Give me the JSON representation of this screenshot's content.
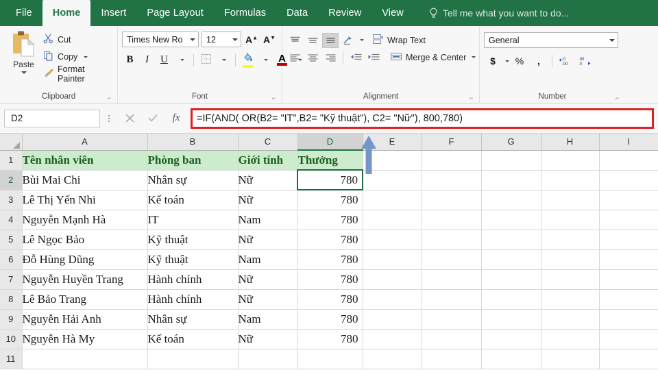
{
  "ribbon": {
    "tabs": [
      {
        "label": "File",
        "active": false
      },
      {
        "label": "Home",
        "active": true
      },
      {
        "label": "Insert",
        "active": false
      },
      {
        "label": "Page Layout",
        "active": false
      },
      {
        "label": "Formulas",
        "active": false
      },
      {
        "label": "Data",
        "active": false
      },
      {
        "label": "Review",
        "active": false
      },
      {
        "label": "View",
        "active": false
      }
    ],
    "tell_me": "Tell me what you want to do...",
    "tell_me_icon": "lightbulb-icon",
    "groups": {
      "clipboard": {
        "title": "Clipboard",
        "paste": "Paste",
        "cut": "Cut",
        "copy": "Copy",
        "format_painter": "Format Painter"
      },
      "font": {
        "title": "Font",
        "font_name": "Times New Ro",
        "font_size": "12",
        "grow_font": "A",
        "shrink_font": "A",
        "bold": "B",
        "italic": "I",
        "underline": "U",
        "fill_color_hex": "#ffff00",
        "font_color_hex": "#c00000"
      },
      "alignment": {
        "title": "Alignment",
        "wrap_text": "Wrap Text",
        "merge_center": "Merge & Center"
      },
      "number": {
        "title": "Number",
        "format": "General",
        "currency": "$",
        "percent": "%",
        "comma": ",",
        "increase_decimal": ".00",
        "decrease_decimal": ".00"
      }
    },
    "theme_hex": "#217346"
  },
  "formula_bar": {
    "name_box": "D2",
    "cancel_icon": "close-icon",
    "confirm_icon": "check-icon",
    "function_icon": "fx",
    "formula": "=IF(AND( OR(B2= \"IT\",B2= \"Kỹ thuật\"), C2= \"Nữ\"), 800,780)",
    "highlight_hex": "#e02020"
  },
  "sheet": {
    "column_headers": [
      "A",
      "B",
      "C",
      "D",
      "E",
      "F",
      "G",
      "H",
      "I"
    ],
    "selected_column": "D",
    "selected_cell": "D2",
    "row_numbers": [
      "1",
      "2",
      "3",
      "4",
      "5",
      "6",
      "7",
      "8",
      "9",
      "10",
      "11"
    ],
    "header_row": [
      "Tên nhân viên",
      "Phòng ban",
      "Giới tính",
      "Thưởng"
    ],
    "header_fill_hex": "#cdeccd",
    "header_text_hex": "#1b5e20",
    "rows": [
      {
        "name": "Bùi Mai Chi",
        "dept": "Nhân sự",
        "gender": "Nữ",
        "bonus": "780"
      },
      {
        "name": "Lê Thị Yến Nhi",
        "dept": "Kế toán",
        "gender": "Nữ",
        "bonus": "780"
      },
      {
        "name": "Nguyễn Mạnh Hà",
        "dept": "IT",
        "gender": "Nam",
        "bonus": "780"
      },
      {
        "name": "Lê Ngọc Bảo",
        "dept": "Kỹ thuật",
        "gender": "Nữ",
        "bonus": "780"
      },
      {
        "name": "Đỗ Hùng Dũng",
        "dept": "Kỹ thuật",
        "gender": "Nam",
        "bonus": "780"
      },
      {
        "name": "Nguyễn Huyền Trang",
        "dept": "Hành chính",
        "gender": "Nữ",
        "bonus": "780"
      },
      {
        "name": "Lê Bảo Trang",
        "dept": "Hành chính",
        "gender": "Nữ",
        "bonus": "780"
      },
      {
        "name": "Nguyễn Hải Anh",
        "dept": "Nhân sự",
        "gender": "Nam",
        "bonus": "780"
      },
      {
        "name": "Nguyễn Hà My",
        "dept": "Kế toán",
        "gender": "Nữ",
        "bonus": "780"
      }
    ]
  },
  "annotation": {
    "arrow_icon": "up-arrow-annotation",
    "arrow_hex": "#7596c8"
  }
}
